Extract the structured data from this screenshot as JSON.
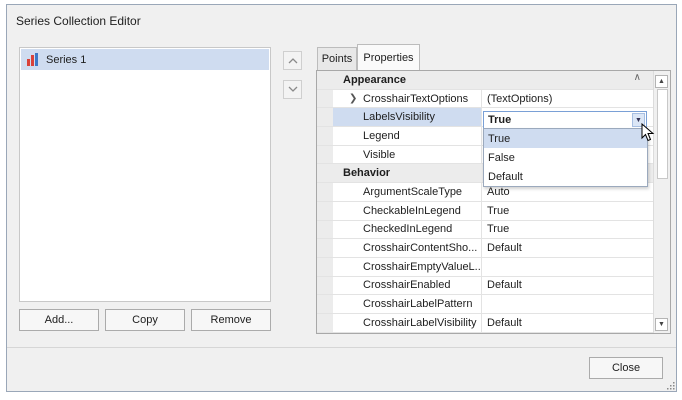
{
  "window": {
    "title": "Series Collection Editor"
  },
  "series_list": {
    "items": [
      {
        "label": "Series 1",
        "icon": "bar-chart-icon"
      }
    ]
  },
  "buttons": {
    "add": "Add...",
    "copy": "Copy",
    "remove": "Remove",
    "close": "Close"
  },
  "tabs": [
    {
      "label": "Points",
      "active": false
    },
    {
      "label": "Properties",
      "active": true
    }
  ],
  "property_grid": {
    "rows": [
      {
        "type": "category",
        "name": "Appearance"
      },
      {
        "type": "property",
        "name": "CrosshairTextOptions",
        "value": "(TextOptions)",
        "expandable": true
      },
      {
        "type": "property",
        "name": "LabelsVisibility",
        "value": "",
        "selected": true
      },
      {
        "type": "property",
        "name": "Legend",
        "value": ""
      },
      {
        "type": "property",
        "name": "Visible",
        "value": ""
      },
      {
        "type": "category",
        "name": "Behavior"
      },
      {
        "type": "property",
        "name": "ArgumentScaleType",
        "value": "Auto"
      },
      {
        "type": "property",
        "name": "CheckableInLegend",
        "value": "True"
      },
      {
        "type": "property",
        "name": "CheckedInLegend",
        "value": "True"
      },
      {
        "type": "property",
        "name": "CrosshairContentSho...",
        "value": "Default"
      },
      {
        "type": "property",
        "name": "CrosshairEmptyValueL...",
        "value": ""
      },
      {
        "type": "property",
        "name": "CrosshairEnabled",
        "value": "Default"
      },
      {
        "type": "property",
        "name": "CrosshairLabelPattern",
        "value": ""
      },
      {
        "type": "property",
        "name": "CrosshairLabelVisibility",
        "value": "Default"
      }
    ]
  },
  "editor": {
    "value": "True",
    "options": [
      "True",
      "False",
      "Default"
    ],
    "highlighted": "True"
  },
  "colors": {
    "selection": "#cfdcf0",
    "bar_red": "#d9413a",
    "bar_blue": "#3d77c6"
  }
}
